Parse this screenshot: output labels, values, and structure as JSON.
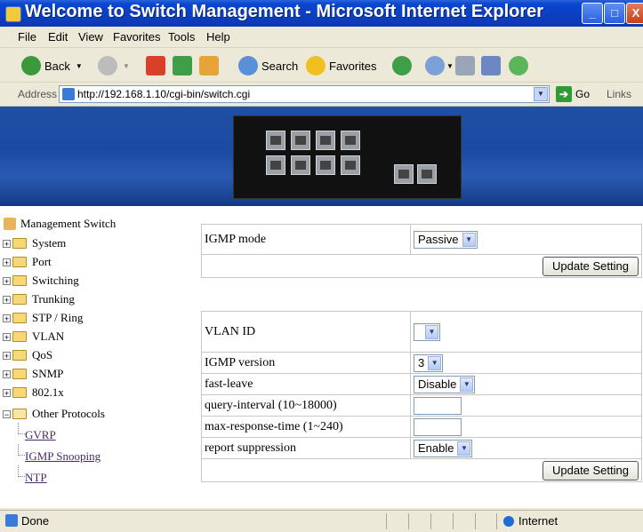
{
  "window": {
    "title": "Welcome to Switch Management - Microsoft Internet Explorer",
    "min_glyph": "_",
    "max_glyph": "□",
    "close_glyph": "X"
  },
  "menu": {
    "items": [
      "File",
      "Edit",
      "View",
      "Favorites",
      "Tools",
      "Help"
    ]
  },
  "toolbar": {
    "back_label": "Back",
    "search_label": "Search",
    "favorites_label": "Favorites"
  },
  "address": {
    "label": "Address",
    "url": "http://192.168.1.10/cgi-bin/switch.cgi",
    "go_label": "Go",
    "links_label": "Links"
  },
  "sidebar": {
    "root": "Management Switch",
    "items": [
      "System",
      "Port",
      "Switching",
      "Trunking",
      "STP / Ring",
      "VLAN",
      "QoS",
      "SNMP",
      "802.1x",
      "Other Protocols"
    ],
    "subitems": [
      "GVRP",
      "IGMP Snooping",
      "NTP"
    ]
  },
  "igmp_mode": {
    "label": "IGMP mode",
    "value": "Passive",
    "update_label": "Update Setting"
  },
  "vlan_form": {
    "vlan_id_label": "VLAN ID",
    "vlan_id_value": "",
    "igmp_version_label": "IGMP version",
    "igmp_version_value": "3",
    "fast_leave_label": "fast-leave",
    "fast_leave_value": "Disable",
    "query_interval_label": "query-interval (10~18000)",
    "query_interval_value": "",
    "max_response_label": "max-response-time (1~240)",
    "max_response_value": "",
    "report_suppression_label": "report suppression",
    "report_suppression_value": "Enable",
    "update_label": "Update Setting"
  },
  "status": {
    "text": "Done",
    "zone": "Internet"
  }
}
